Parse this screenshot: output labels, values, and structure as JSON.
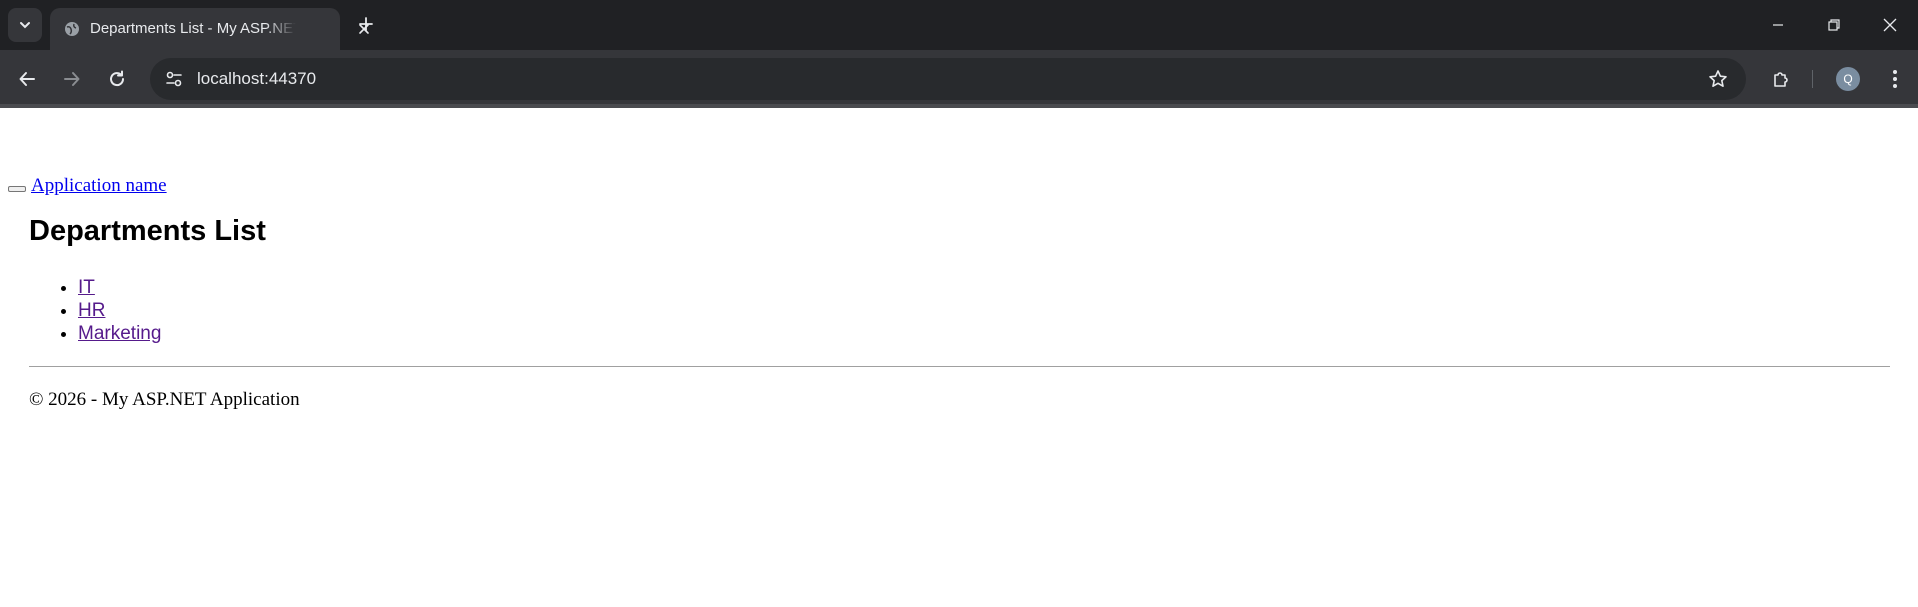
{
  "browser": {
    "tab_title": "Departments List - My ASP.NET Application",
    "url": "localhost:44370",
    "profile_initial": "Q",
    "colors": {
      "frame": "#202124",
      "toolbar": "#35363a",
      "omnibox": "#282a2d"
    }
  },
  "page": {
    "brand": "Application name",
    "title": "Departments List",
    "departments": [
      "IT",
      "HR",
      "Marketing"
    ],
    "footer": "© 2026 - My ASP.NET Application",
    "colors": {
      "link": "#0000ee",
      "visited_link": "#551a8b"
    }
  }
}
